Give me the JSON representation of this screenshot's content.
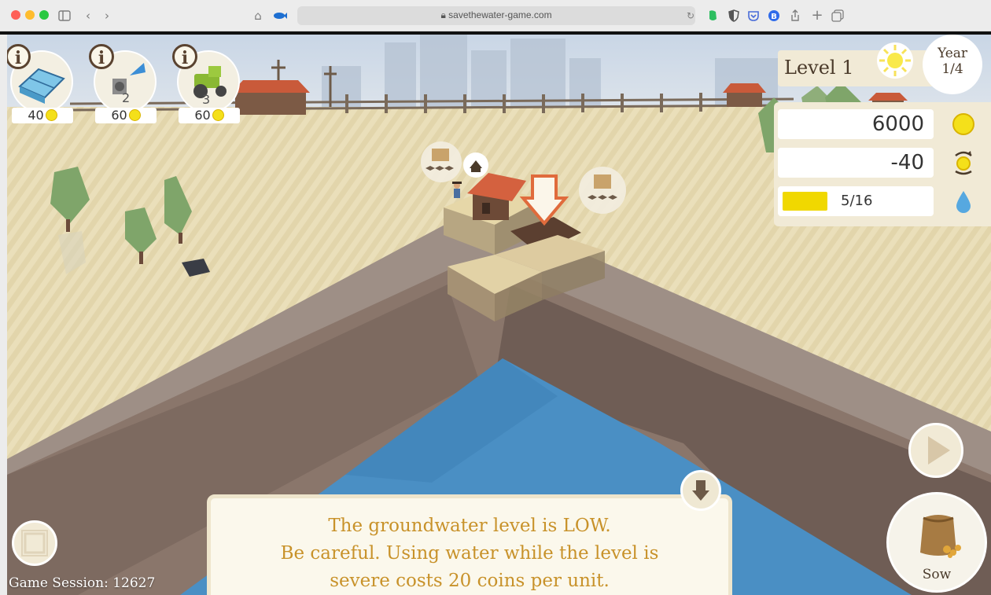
{
  "browser": {
    "url": "savethewater-game.com",
    "icons": [
      "sidebar-icon",
      "back-icon",
      "forward-icon",
      "home-icon",
      "fish-icon",
      "reload-icon",
      "shield-icon",
      "pocket-icon",
      "extension-icon",
      "share-icon",
      "new-tab-icon",
      "tabs-overview-icon"
    ]
  },
  "upgrades": [
    {
      "name": "greenhouse",
      "price": "40"
    },
    {
      "name": "irrigation",
      "price": "60"
    },
    {
      "name": "tractor",
      "price": "60"
    }
  ],
  "hud": {
    "level_label": "Level 1",
    "year_label": "Year",
    "year_value": "1/4",
    "coins": "6000",
    "coin_change": "-40",
    "water_label": "5/16",
    "water_level_fraction": 0.3125
  },
  "message": {
    "lines": [
      "The groundwater level is LOW.",
      "Be careful. Using water while the level is",
      "severe costs 20 coins per unit."
    ]
  },
  "controls": {
    "sow_label": "Sow"
  },
  "session": {
    "label": "Game Session: 12627"
  },
  "colors": {
    "coin": "#f4e01a",
    "water_bar": "#f0d800",
    "message_text": "#c8922a",
    "water": "#4a8fc4",
    "sand": "#e8ddb8"
  }
}
